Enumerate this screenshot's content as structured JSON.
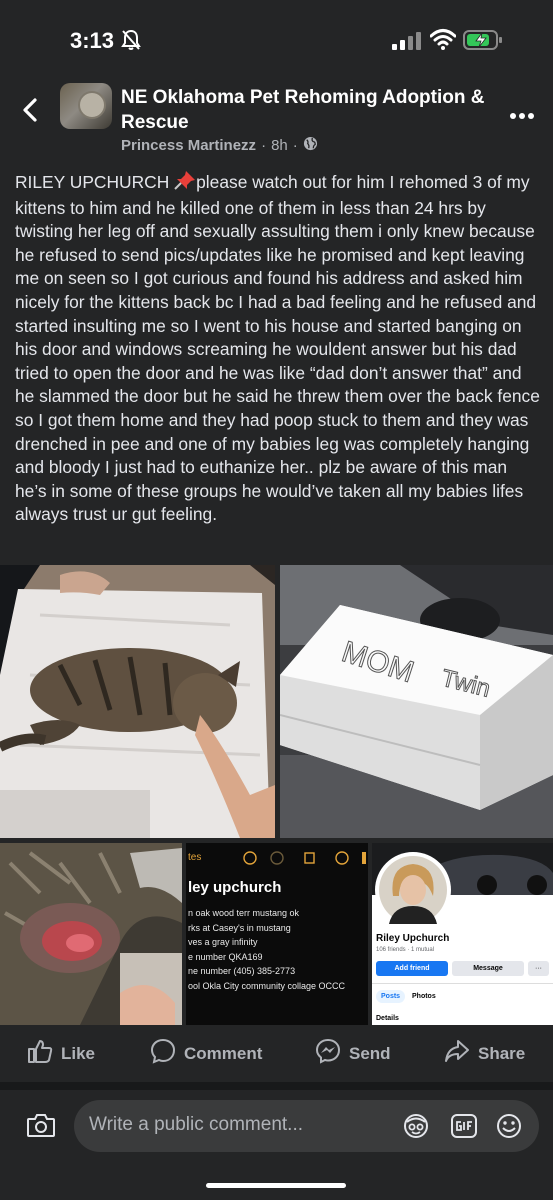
{
  "status_bar": {
    "time": "3:13"
  },
  "header": {
    "group_name": "NE Oklahoma Pet Rehoming Adoption & Rescue",
    "author": "Princess Martinezz",
    "time_ago": "8h",
    "separator": "·"
  },
  "post": {
    "text_before_pin": "RILEY UPCHURCH ",
    "text_after_pin": "please watch out for him I rehomed 3 of my kittens to him and he killed one of them in less than 24 hrs by twisting her leg off and sexually assulting them i only knew because he refused to send pics/updates like he promised and kept leaving me on seen so I got curious and found his address and asked him nicely for the kittens back bc I had a bad feeling and he refused and started insulting me so I went to his house and started banging on his door and windows screaming he wouldent answer but his dad tried to open the door and he was like “dad don’t answer that” and he slammed the door but he said he threw them over the back fence so I got them home and they had poop stuck to them and they was drenched in pee and one of my babies leg was completely hanging and bloody I just had to euthanize her.. plz be aware of this man he’s in some of these groups he would’ve taken all my babies lifes always trust ur gut feeling."
  },
  "photos": {
    "box_writing_line1": "MOM",
    "box_writing_line2": "Twin",
    "notes": {
      "back_label": "tes",
      "title": "ley upchurch",
      "lines": [
        "n oak wood terr mustang ok",
        "rks at Casey's in mustang",
        "ves a gray infinity",
        "e number QKA169",
        "ne number (405) 385-2773",
        "ool Okla City community collage OCCC"
      ]
    },
    "profile": {
      "name": "Riley Upchurch",
      "friends": "106 friends · 1 mutual",
      "add_friend": "Add friend",
      "message": "Message",
      "more": "···",
      "tab_posts": "Posts",
      "tab_photos": "Photos",
      "details": "Details"
    }
  },
  "actions": {
    "like": "Like",
    "comment": "Comment",
    "send": "Send",
    "share": "Share"
  },
  "comment_bar": {
    "placeholder": "Write a public comment..."
  },
  "icons": {
    "status": [
      "bell-slash-icon",
      "cellular-signal-icon",
      "wifi-icon",
      "battery-charging-icon"
    ],
    "header": [
      "back-arrow-icon",
      "more-options-icon",
      "globe-icon"
    ],
    "post": [
      "pushpin-icon"
    ],
    "actions": [
      "like-icon",
      "comment-icon",
      "messenger-icon",
      "share-icon"
    ],
    "comment_bar": [
      "camera-icon",
      "avatar-sticker-icon",
      "gif-icon",
      "emoji-icon"
    ]
  },
  "colors": {
    "background": "#242526",
    "text": "#e4e6eb",
    "secondary": "#b0b3b8",
    "accent": "#1877f2",
    "battery": "#34c759"
  }
}
